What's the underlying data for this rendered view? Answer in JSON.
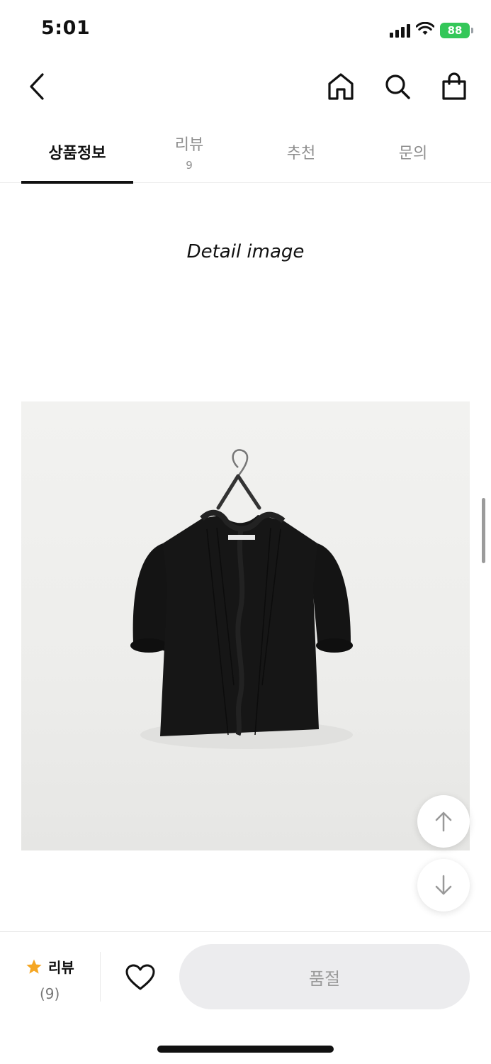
{
  "status_bar": {
    "time": "5:01",
    "battery": "88"
  },
  "tabs": [
    {
      "label": "상품정보",
      "count": ""
    },
    {
      "label": "리뷰",
      "count": "9"
    },
    {
      "label": "추천",
      "count": ""
    },
    {
      "label": "문의",
      "count": ""
    }
  ],
  "content": {
    "heading": "Detail image"
  },
  "bottom_bar": {
    "review_label": "리뷰",
    "review_count": "(9)",
    "action_label": "품절"
  },
  "colors": {
    "accent_star": "#f5a623",
    "battery": "#34c759",
    "soldout_bg": "#ececee"
  },
  "icons": [
    "chevron-left-icon",
    "home-icon",
    "search-icon",
    "shopping-bag-icon",
    "arrow-up-icon",
    "arrow-down-icon",
    "star-icon",
    "heart-icon"
  ]
}
